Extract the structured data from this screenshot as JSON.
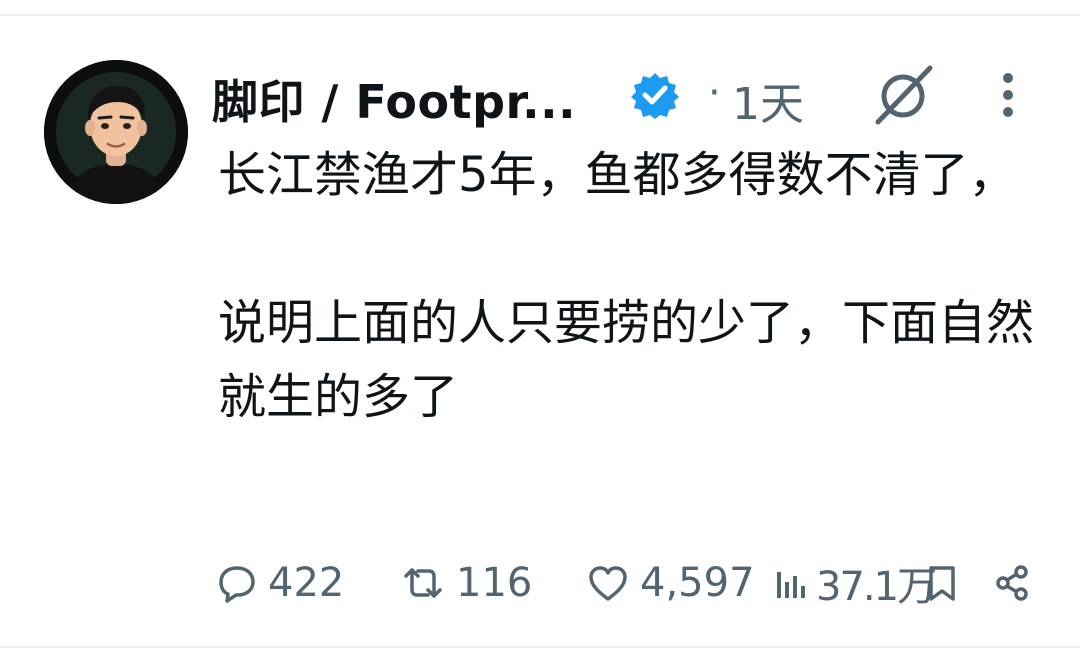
{
  "author": {
    "name": "脚印 / Footpr...",
    "verified": true,
    "time_separator": "·",
    "time": "1天"
  },
  "tweet": {
    "paragraphs": [
      "长江禁渔才5年，鱼都多得数不清了，",
      "说明上面的人只要捞的少了，下面自然就生的多了"
    ]
  },
  "stats": {
    "replies": "422",
    "retweets": "116",
    "likes": "4,597",
    "views": "37.1万"
  },
  "colors": {
    "text": "#0f1419",
    "muted": "#536471",
    "verified_blue": "#1d9bf0"
  },
  "icons": [
    "avatar",
    "verified-badge-icon",
    "grok-icon",
    "more-icon",
    "reply-icon",
    "retweet-icon",
    "like-icon",
    "views-icon",
    "bookmark-icon",
    "share-icon"
  ]
}
